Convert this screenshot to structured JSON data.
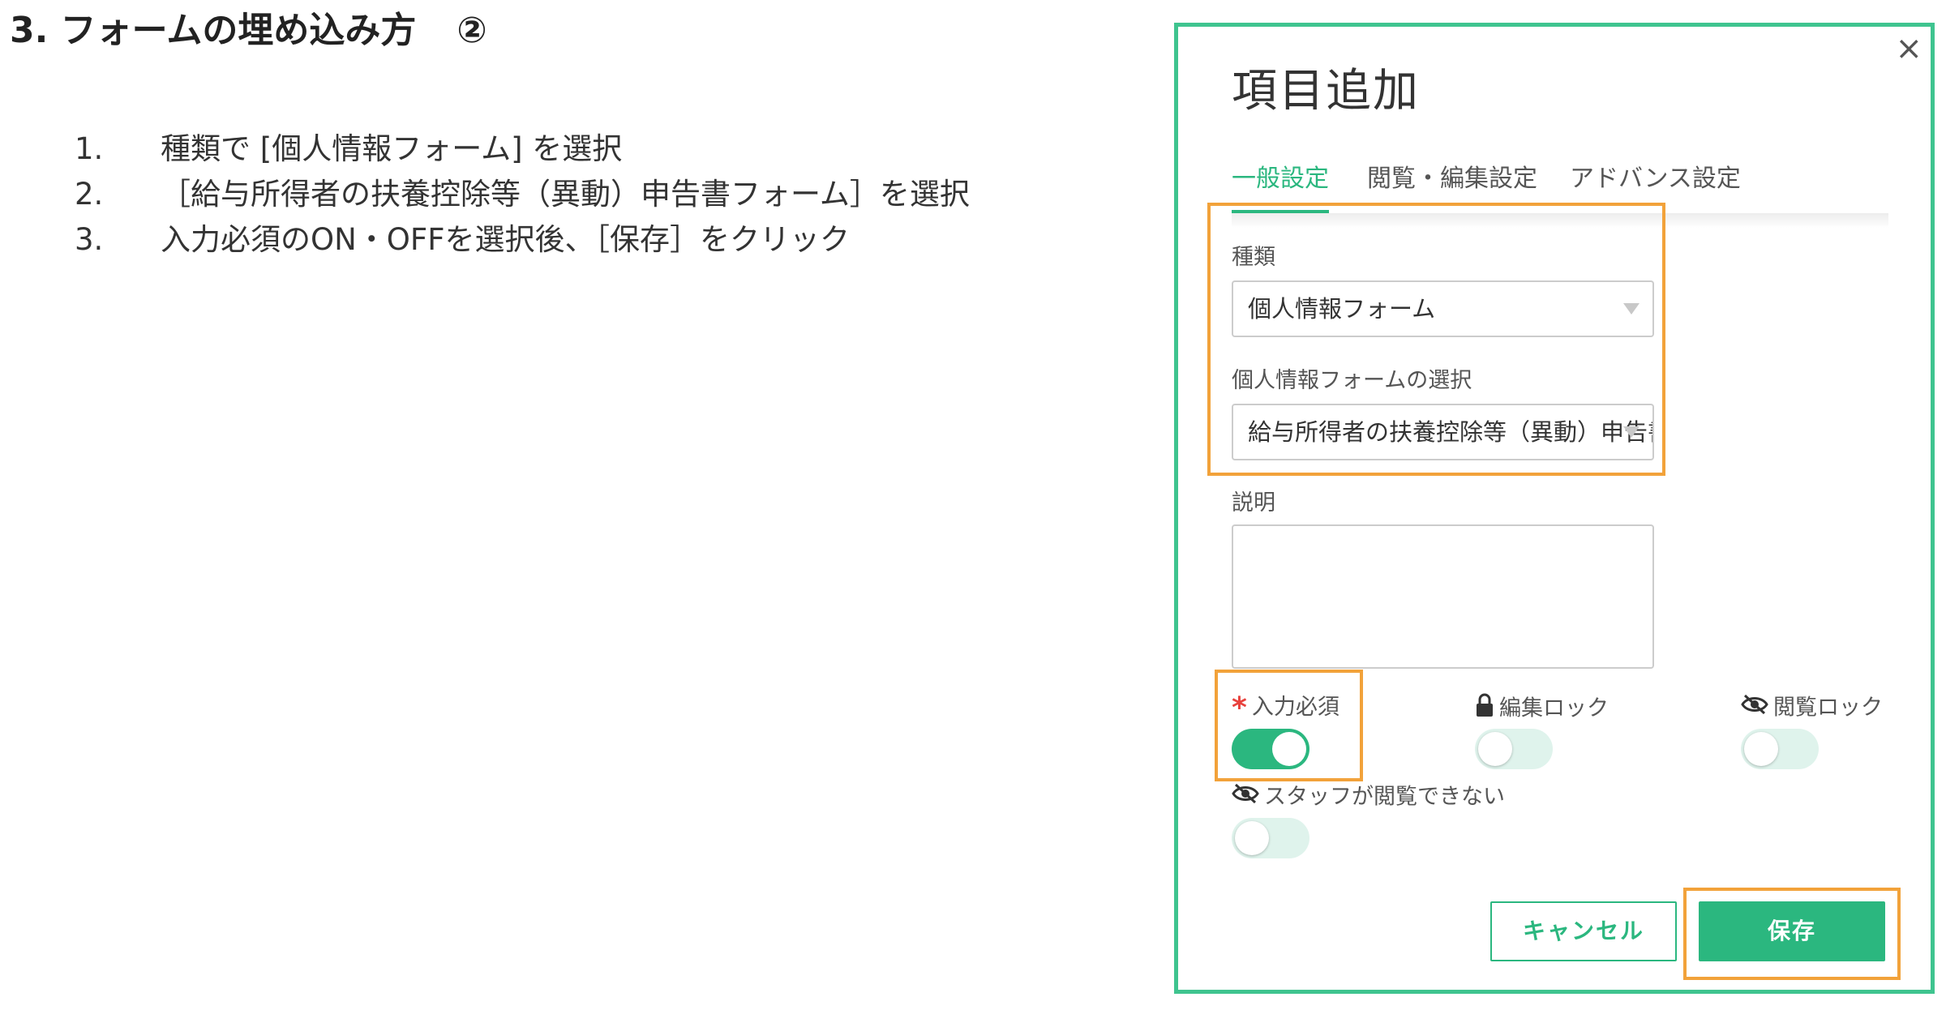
{
  "slide": {
    "title": "3.   フォームの埋め込み方",
    "title_circle": "②",
    "steps": [
      {
        "num": "1.",
        "text": "種類で [個人情報フォーム] を選択"
      },
      {
        "num": "2.",
        "text": "［給与所得者の扶養控除等（異動）申告書フォーム］を選択"
      },
      {
        "num": "3.",
        "text": "入力必須のON・OFFを選択後、［保存］をクリック"
      }
    ]
  },
  "modal": {
    "close": "×",
    "title": "項目追加",
    "tabs": [
      {
        "label": "一般設定",
        "active": true
      },
      {
        "label": "閲覧・編集設定",
        "active": false
      },
      {
        "label": "アドバンス設定",
        "active": false
      }
    ],
    "type_field": {
      "label": "種類",
      "value": "個人情報フォーム"
    },
    "form_field": {
      "label": "個人情報フォームの選択",
      "value": "給与所得者の扶養控除等（異動）申告書フォーム"
    },
    "description_field": {
      "label": "説明",
      "value": ""
    },
    "toggles": {
      "required": {
        "label": "入力必須",
        "icon": "asterisk-icon",
        "on": true
      },
      "edit_lock": {
        "label": "編集ロック",
        "icon": "lock-icon",
        "on": false
      },
      "view_lock": {
        "label": "閲覧ロック",
        "icon": "eye-slash-icon",
        "on": false
      },
      "staff_hidden": {
        "label": "スタッフが閲覧できない",
        "icon": "eye-slash-icon",
        "on": false
      }
    },
    "buttons": {
      "cancel": "キャンセル",
      "save": "保存"
    }
  },
  "colors": {
    "accent": "#2bb77f",
    "frame": "#3fc48f",
    "highlight": "#f2a23a",
    "required": "#e8413c"
  }
}
